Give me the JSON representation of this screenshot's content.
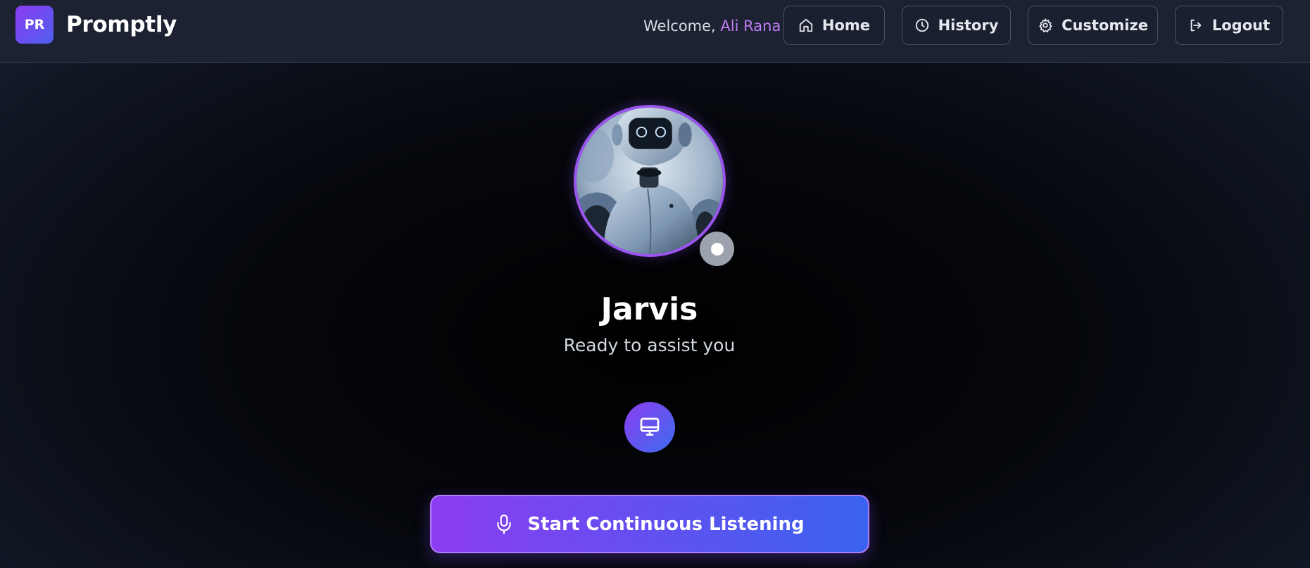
{
  "app": {
    "logo_text": "PR",
    "name": "Promptly"
  },
  "header": {
    "welcome_prefix": "Welcome, ",
    "user_name": "Ali Rana",
    "nav": [
      {
        "label": "Home",
        "icon": "home-icon"
      },
      {
        "label": "History",
        "icon": "clock-icon"
      },
      {
        "label": "Customize",
        "icon": "gear-icon"
      },
      {
        "label": "Logout",
        "icon": "logout-icon"
      }
    ]
  },
  "assistant": {
    "name": "Jarvis",
    "status": "Ready to assist you",
    "avatar": "robot-avatar-image",
    "status_indicator_color": "#9ca3af"
  },
  "actions": {
    "screen_icon": "monitor-icon",
    "listen_label": "Start Continuous Listening",
    "listen_icon": "microphone-icon"
  },
  "colors": {
    "accent_purple": "#8b3df0",
    "accent_blue": "#3a63ef",
    "user_name_color": "#c07cf8",
    "header_bg": "#1c2231"
  }
}
